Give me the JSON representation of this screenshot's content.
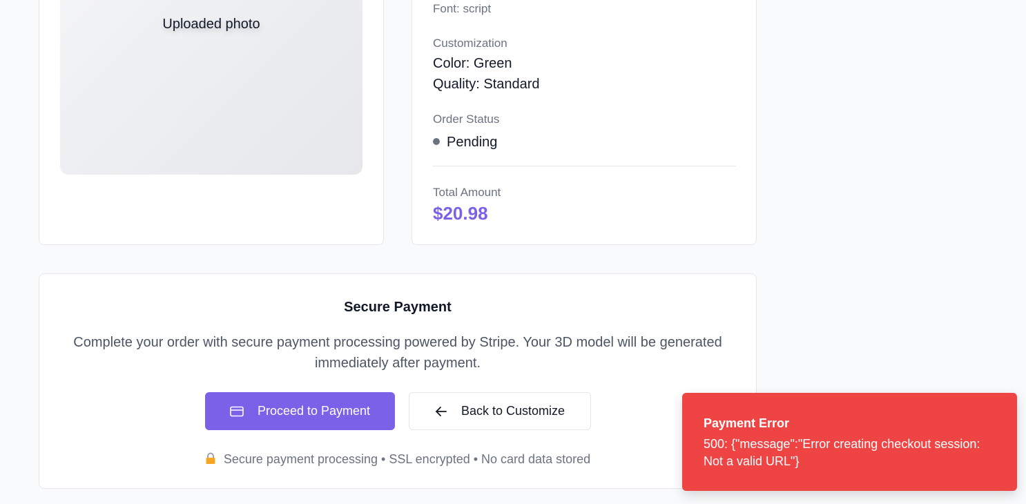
{
  "photo": {
    "label": "Uploaded photo"
  },
  "details": {
    "font_line": "Font: script",
    "customization_heading": "Customization",
    "color_line": "Color: Green",
    "quality_line": "Quality: Standard",
    "status_heading": "Order Status",
    "status_value": "Pending",
    "total_heading": "Total Amount",
    "total_value": "$20.98"
  },
  "payment": {
    "title": "Secure Payment",
    "description": "Complete your order with secure payment processing powered by Stripe. Your 3D model will be generated immediately after payment.",
    "proceed_label": "Proceed to Payment",
    "proceed_icon": "credit-card-icon",
    "back_label": "Back to Customize",
    "back_icon": "arrow-left-icon",
    "secure_note": "Secure payment processing • SSL encrypted • No card data stored",
    "secure_icon": "lock-icon"
  },
  "toast": {
    "title": "Payment Error",
    "message": "500: {\"message\":\"Error creating checkout session: Not a valid URL\"}"
  },
  "colors": {
    "accent": "#7b61e8",
    "error": "#ef4444",
    "status_dot": "#6b7280"
  }
}
